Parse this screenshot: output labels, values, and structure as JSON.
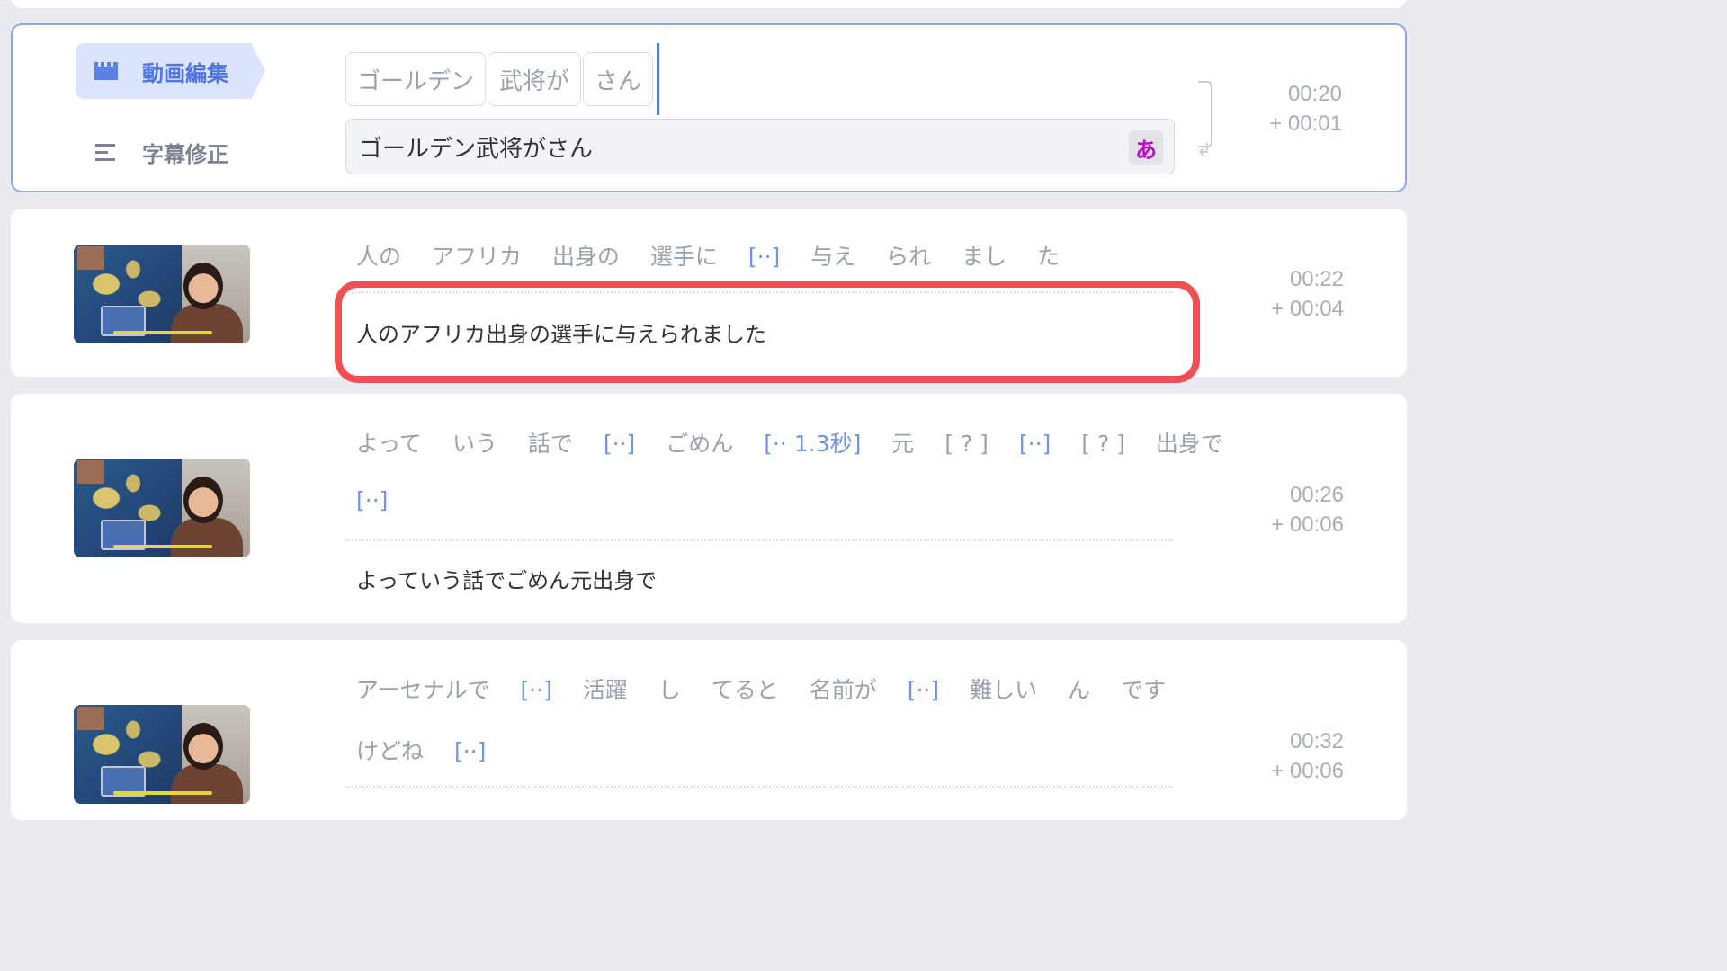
{
  "active_segment": {
    "modes": {
      "video_edit": "動画編集",
      "subtitle_edit": "字幕修正"
    },
    "chips": [
      "ゴールデン",
      "武将が",
      "さん"
    ],
    "text": "ゴールデン武将がさん",
    "ime_button": "あ",
    "time": "00:20",
    "duration": "+ 00:01"
  },
  "segments": [
    {
      "tokens": [
        "人の",
        "アフリカ",
        "出身の",
        "選手に",
        "[··]",
        "与え",
        "られ",
        "まし",
        "た"
      ],
      "text": "人のアフリカ出身の選手に与えられました",
      "time": "00:22",
      "duration": "+ 00:04"
    },
    {
      "tokens_line1": [
        "よって",
        "いう",
        "話で",
        "[··]",
        "ごめん",
        "[·· 1.3秒]",
        "元",
        "[ ? ]",
        "[··]",
        "[ ? ]",
        "出身で"
      ],
      "tokens_line2": [
        "[··]"
      ],
      "text": "よっていう話でごめん元出身で",
      "time": "00:26",
      "duration": "+ 00:06"
    },
    {
      "tokens_line1": [
        "アーセナルで",
        "[··]",
        "活躍",
        "し",
        "てると",
        "名前が",
        "[··]",
        "難しい",
        "ん",
        "です"
      ],
      "tokens_line2": [
        "けどね",
        "[··]"
      ],
      "time": "00:32",
      "duration": "+ 00:06"
    }
  ],
  "colors": {
    "accent": "#4e75e2",
    "highlight": "#f24f55",
    "gap_token": "#6f95ea"
  }
}
